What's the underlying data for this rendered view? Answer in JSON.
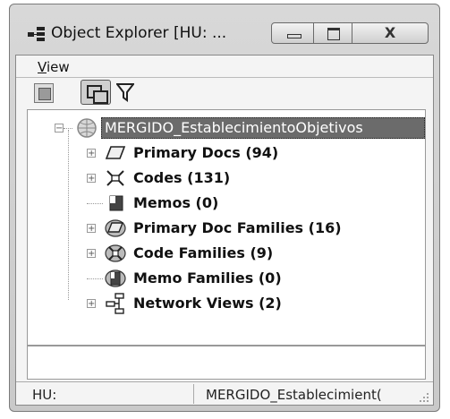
{
  "window": {
    "title": "Object Explorer  [HU: ...",
    "icons": {
      "app": "object-explorer-icon"
    },
    "controls": {
      "minimize": "minimize-icon",
      "maximize": "maximize-icon",
      "close_glyph": "X"
    }
  },
  "menu": {
    "view_label": "View",
    "view_mnemonic": "V",
    "view_rest": "iew"
  },
  "toolbar": {
    "buttons": [
      "single-pane-icon",
      "split-view-icon",
      "filter-icon"
    ]
  },
  "tree": {
    "root": {
      "label": "MERGIDO_EstablecimientoObjetivos",
      "icon": "globe-project-icon",
      "expanded": true
    },
    "items": [
      {
        "label": "Primary Docs (94)",
        "icon": "primary-doc-icon",
        "expandable": true
      },
      {
        "label": "Codes (131)",
        "icon": "codes-icon",
        "expandable": true
      },
      {
        "label": "Memos (0)",
        "icon": "memo-icon",
        "expandable": false
      },
      {
        "label": "Primary Doc Families (16)",
        "icon": "primary-doc-family-icon",
        "expandable": true
      },
      {
        "label": "Code Families (9)",
        "icon": "code-family-icon",
        "expandable": true
      },
      {
        "label": "Memo Families (0)",
        "icon": "memo-family-icon",
        "expandable": false
      },
      {
        "label": "Network Views (2)",
        "icon": "network-view-icon",
        "expandable": true
      }
    ]
  },
  "input": {
    "value": ""
  },
  "status": {
    "left": "HU:",
    "right": "MERGIDO_Establecimient("
  }
}
